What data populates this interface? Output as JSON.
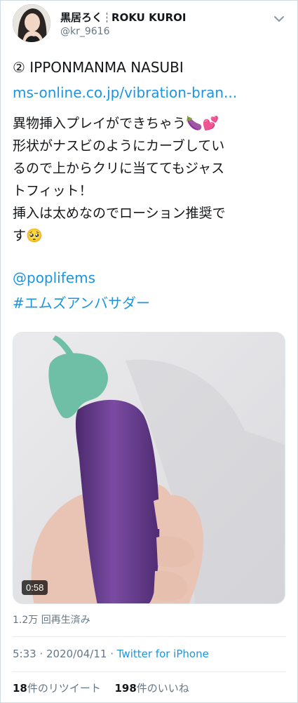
{
  "user": {
    "display_name": "黒居ろく",
    "display_name_en": "ROKU KUROI",
    "handle": "@kr_9616"
  },
  "tweet": {
    "title": "② IPPONMANMA NASUBI",
    "link": "ms-online.co.jp/vibration-bran...",
    "lines": [
      "異物挿入プレイができちゃう🍆💕",
      "形状がナスビのようにカーブしてい",
      "るので上からクリに当ててもジャス",
      "トフィット！",
      "挿入は太めなのでローション推奨で",
      "す🥺"
    ],
    "mention": "@poplifems",
    "hashtag": "#エムズアンバサダー"
  },
  "media": {
    "duration": "0:58",
    "views": "1.2万 回再生済み"
  },
  "meta": {
    "time": "5:33 · 2020/04/11 · ",
    "source": "Twitter for iPhone"
  },
  "stats": {
    "retweets_count": "18",
    "retweets_label": "件のリツイート",
    "likes_count": "198",
    "likes_label": "件のいいね"
  },
  "colors": {
    "link": "#1b95e0",
    "secondary_text": "#657786",
    "eggplant": "#6a3f8f",
    "stem": "#6fbfa6"
  }
}
